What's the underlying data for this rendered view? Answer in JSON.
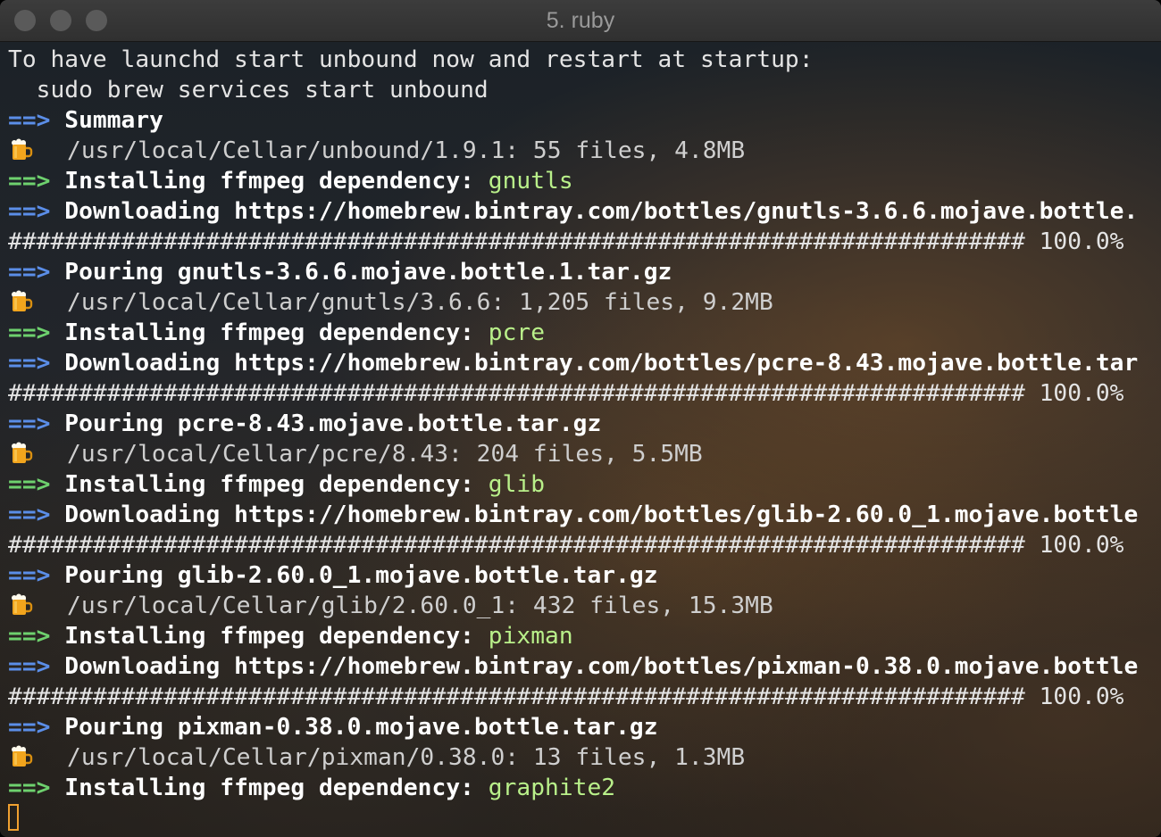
{
  "window": {
    "title": "5. ruby",
    "colors": {
      "titlebar": "#353535",
      "arrow_blue": "#5b8ee8",
      "arrow_green": "#6ed16e",
      "package": "#b9f08a",
      "cursor": "#f0a030"
    }
  },
  "terminal": {
    "lines": [
      {
        "type": "text",
        "text": "To have launchd start unbound now and restart at startup:"
      },
      {
        "type": "text",
        "text": "  sudo brew services start unbound"
      },
      {
        "type": "step",
        "arrow": "==>",
        "color": "blue",
        "text": "Summary",
        "pkg": ""
      },
      {
        "type": "beer",
        "icon": "beer-mug-icon",
        "text": "/usr/local/Cellar/unbound/1.9.1: 55 files, 4.8MB"
      },
      {
        "type": "step",
        "arrow": "==>",
        "color": "green",
        "text": "Installing ffmpeg dependency: ",
        "pkg": "gnutls"
      },
      {
        "type": "step",
        "arrow": "==>",
        "color": "blue",
        "text": "Downloading https://homebrew.bintray.com/bottles/gnutls-3.6.6.mojave.bottle.",
        "pkg": ""
      },
      {
        "type": "progress",
        "text": "######################################################################## 100.0%"
      },
      {
        "type": "step",
        "arrow": "==>",
        "color": "blue",
        "text": "Pouring gnutls-3.6.6.mojave.bottle.1.tar.gz",
        "pkg": ""
      },
      {
        "type": "beer",
        "icon": "beer-mug-icon",
        "text": "/usr/local/Cellar/gnutls/3.6.6: 1,205 files, 9.2MB"
      },
      {
        "type": "step",
        "arrow": "==>",
        "color": "green",
        "text": "Installing ffmpeg dependency: ",
        "pkg": "pcre"
      },
      {
        "type": "step",
        "arrow": "==>",
        "color": "blue",
        "text": "Downloading https://homebrew.bintray.com/bottles/pcre-8.43.mojave.bottle.tar",
        "pkg": ""
      },
      {
        "type": "progress",
        "text": "######################################################################## 100.0%"
      },
      {
        "type": "step",
        "arrow": "==>",
        "color": "blue",
        "text": "Pouring pcre-8.43.mojave.bottle.tar.gz",
        "pkg": ""
      },
      {
        "type": "beer",
        "icon": "beer-mug-icon",
        "text": "/usr/local/Cellar/pcre/8.43: 204 files, 5.5MB"
      },
      {
        "type": "step",
        "arrow": "==>",
        "color": "green",
        "text": "Installing ffmpeg dependency: ",
        "pkg": "glib"
      },
      {
        "type": "step",
        "arrow": "==>",
        "color": "blue",
        "text": "Downloading https://homebrew.bintray.com/bottles/glib-2.60.0_1.mojave.bottle",
        "pkg": ""
      },
      {
        "type": "progress",
        "text": "######################################################################## 100.0%"
      },
      {
        "type": "step",
        "arrow": "==>",
        "color": "blue",
        "text": "Pouring glib-2.60.0_1.mojave.bottle.tar.gz",
        "pkg": ""
      },
      {
        "type": "beer",
        "icon": "beer-mug-icon",
        "text": "/usr/local/Cellar/glib/2.60.0_1: 432 files, 15.3MB"
      },
      {
        "type": "step",
        "arrow": "==>",
        "color": "green",
        "text": "Installing ffmpeg dependency: ",
        "pkg": "pixman"
      },
      {
        "type": "step",
        "arrow": "==>",
        "color": "blue",
        "text": "Downloading https://homebrew.bintray.com/bottles/pixman-0.38.0.mojave.bottle",
        "pkg": ""
      },
      {
        "type": "progress",
        "text": "######################################################################## 100.0%"
      },
      {
        "type": "step",
        "arrow": "==>",
        "color": "blue",
        "text": "Pouring pixman-0.38.0.mojave.bottle.tar.gz",
        "pkg": ""
      },
      {
        "type": "beer",
        "icon": "beer-mug-icon",
        "text": "/usr/local/Cellar/pixman/0.38.0: 13 files, 1.3MB"
      },
      {
        "type": "step",
        "arrow": "==>",
        "color": "green",
        "text": "Installing ffmpeg dependency: ",
        "pkg": "graphite2"
      },
      {
        "type": "cursor"
      }
    ]
  }
}
